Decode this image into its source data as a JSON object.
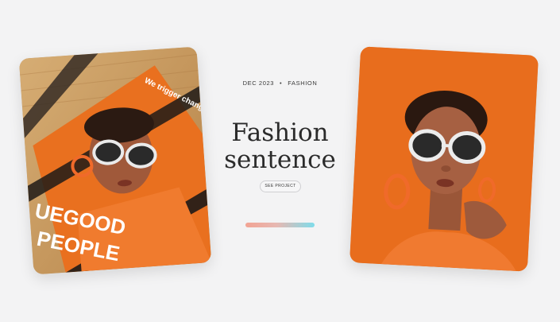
{
  "meta": {
    "date": "DEC 2023",
    "separator": "•",
    "category": "FASHION"
  },
  "title": {
    "line1": "Fashion",
    "line2": "sentence"
  },
  "cta": {
    "label": "SEE PROJECT"
  },
  "poster_text": {
    "headline": "We trigger change",
    "big1": "UEGOOD",
    "big2": "PEOPLE"
  },
  "colors": {
    "accent_orange": "#e86d1d",
    "background": "#f3f3f4",
    "progress_start": "#f2a393",
    "progress_end": "#7fdcea"
  }
}
